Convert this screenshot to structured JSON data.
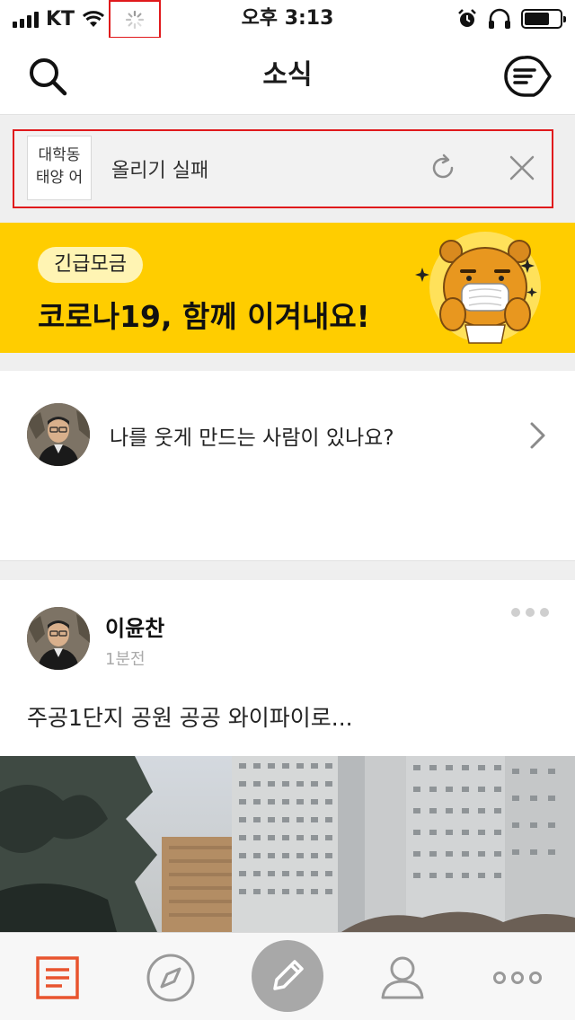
{
  "status_bar": {
    "carrier": "KT",
    "time": "오후 3:13",
    "icons": [
      "signal-icon",
      "wifi-icon",
      "loading-spinner-icon",
      "alarm-icon",
      "headphones-icon",
      "battery-icon"
    ]
  },
  "header": {
    "title": "소식",
    "left_icon": "search-icon",
    "right_icon": "compose-icon"
  },
  "upload_failure": {
    "thumbnail_text_line1": "대학동",
    "thumbnail_text_line2": "태양 어",
    "message": "올리기 실패",
    "retry_icon": "retry-icon",
    "close_icon": "close-icon"
  },
  "banner": {
    "tag": "긴급모금",
    "headline": "코로나19, 함께 이겨내요!",
    "background_color": "#ffcd00"
  },
  "question_card": {
    "question": "나를 웃게 만드는 사람이 있나요?"
  },
  "post": {
    "author": "이윤찬",
    "time": "1분전",
    "content": "주공1단지 공원 공공 와이파이로..."
  },
  "tab_bar": {
    "tabs": [
      "feed-icon",
      "explore-compass-icon",
      "write-pencil-icon",
      "profile-icon",
      "more-dots-icon"
    ],
    "active_color": "#e8542e"
  }
}
